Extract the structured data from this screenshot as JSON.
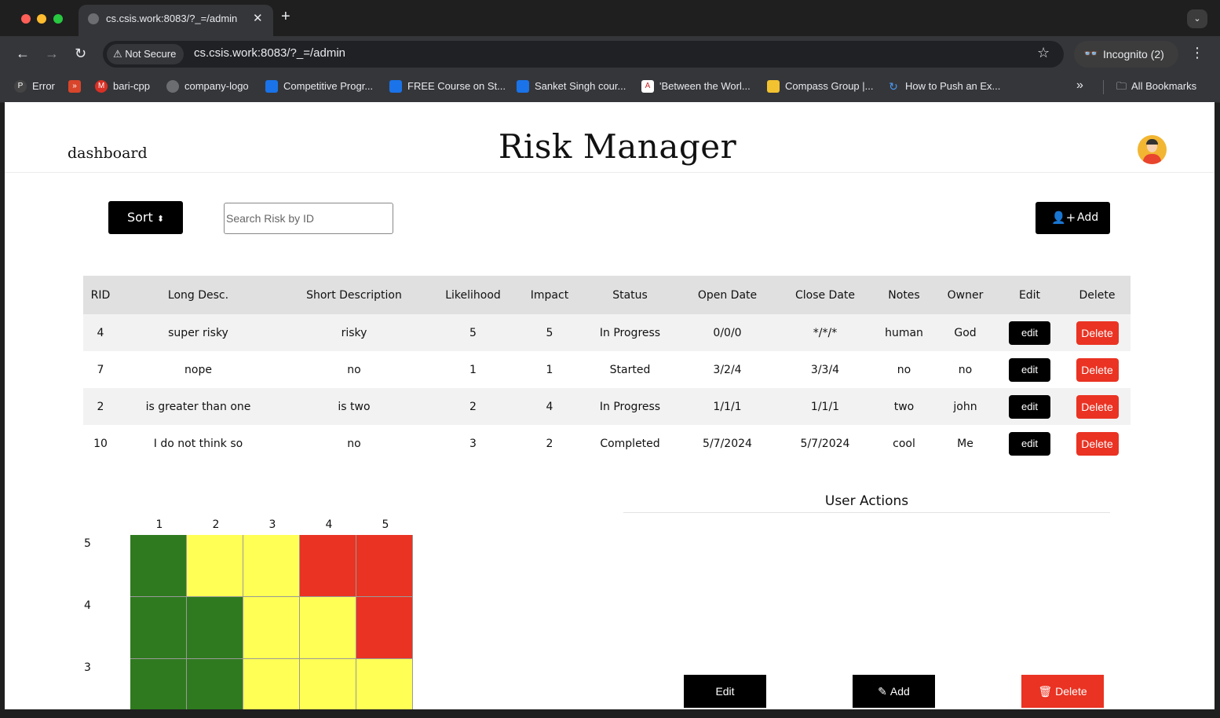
{
  "browser": {
    "tab_title": "cs.csis.work:8083/?_=/admin",
    "tab_close": "✕",
    "new_tab": "+",
    "tab_menu": "⌄",
    "not_secure": "Not Secure",
    "url": "cs.csis.work:8083/?_=/admin",
    "incognito": "Incognito (2)",
    "bookmarks": [
      {
        "label": "Error",
        "icon": "error-icon",
        "color": "#444444"
      },
      {
        "label": "",
        "icon": "git-icon",
        "color": "#d8452b"
      },
      {
        "label": "bari-cpp",
        "icon": "gmail-icon",
        "color": "#d93025"
      },
      {
        "label": "company-logo",
        "icon": "globe-icon",
        "color": "#6b6d70"
      },
      {
        "label": "Competitive Progr...",
        "icon": "bookmark-icon",
        "color": "#1a73e8"
      },
      {
        "label": "FREE Course on St...",
        "icon": "bookmark-icon",
        "color": "#1a73e8"
      },
      {
        "label": "Sanket Singh cour...",
        "icon": "bookmark-icon",
        "color": "#1a73e8"
      },
      {
        "label": "'Between the Worl...",
        "icon": "pdf-icon",
        "color": "#c62828"
      },
      {
        "label": "Compass Group |...",
        "icon": "doc-icon",
        "color": "#f2c230"
      },
      {
        "label": "How to Push an Ex...",
        "icon": "sync-icon",
        "color": "#1a73e8"
      }
    ],
    "all_bookmarks": "All Bookmarks"
  },
  "header": {
    "nav_dashboard": "dashboard",
    "title": "Risk Manager"
  },
  "controls": {
    "sort_label": "Sort",
    "search_placeholder": "Search Risk by ID",
    "add_label": "Add"
  },
  "table": {
    "columns": [
      "RID",
      "Long Desc.",
      "Short Description",
      "Likelihood",
      "Impact",
      "Status",
      "Open Date",
      "Close Date",
      "Notes",
      "Owner",
      "Edit",
      "Delete"
    ],
    "rows": [
      {
        "rid": "4",
        "long_desc": "super risky",
        "short_desc": "risky",
        "likelihood": "5",
        "impact": "5",
        "status": "In Progress",
        "open_date": "0/0/0",
        "close_date": "*/*/*",
        "notes": "human",
        "owner": "God",
        "edit": "edit",
        "delete": "Delete"
      },
      {
        "rid": "7",
        "long_desc": "nope",
        "short_desc": "no",
        "likelihood": "1",
        "impact": "1",
        "status": "Started",
        "open_date": "3/2/4",
        "close_date": "3/3/4",
        "notes": "no",
        "owner": "no",
        "edit": "edit",
        "delete": "Delete"
      },
      {
        "rid": "2",
        "long_desc": "is greater than one",
        "short_desc": "is two",
        "likelihood": "2",
        "impact": "4",
        "status": "In Progress",
        "open_date": "1/1/1",
        "close_date": "1/1/1",
        "notes": "two",
        "owner": "john",
        "edit": "edit",
        "delete": "Delete"
      },
      {
        "rid": "10",
        "long_desc": "I do not think so",
        "short_desc": "no",
        "likelihood": "3",
        "impact": "2",
        "status": "Completed",
        "open_date": "5/7/2024",
        "close_date": "5/7/2024",
        "notes": "cool",
        "owner": "Me",
        "edit": "edit",
        "delete": "Delete"
      }
    ]
  },
  "matrix": {
    "columns": [
      "1",
      "2",
      "3",
      "4",
      "5"
    ],
    "rows": [
      {
        "label": "5",
        "cells": [
          "green",
          "yellow",
          "yellow",
          "red",
          "red"
        ]
      },
      {
        "label": "4",
        "cells": [
          "green",
          "green",
          "yellow",
          "yellow",
          "red"
        ]
      },
      {
        "label": "3",
        "cells": [
          "green",
          "green",
          "yellow",
          "yellow",
          "yellow"
        ]
      }
    ],
    "colors": {
      "green": "#2f7a1f",
      "yellow": "#ffff55",
      "red": "#ea3323"
    }
  },
  "user_actions": {
    "title": "User Actions",
    "edit_label": "Edit",
    "add_label": "Add",
    "delete_label": "Delete"
  }
}
